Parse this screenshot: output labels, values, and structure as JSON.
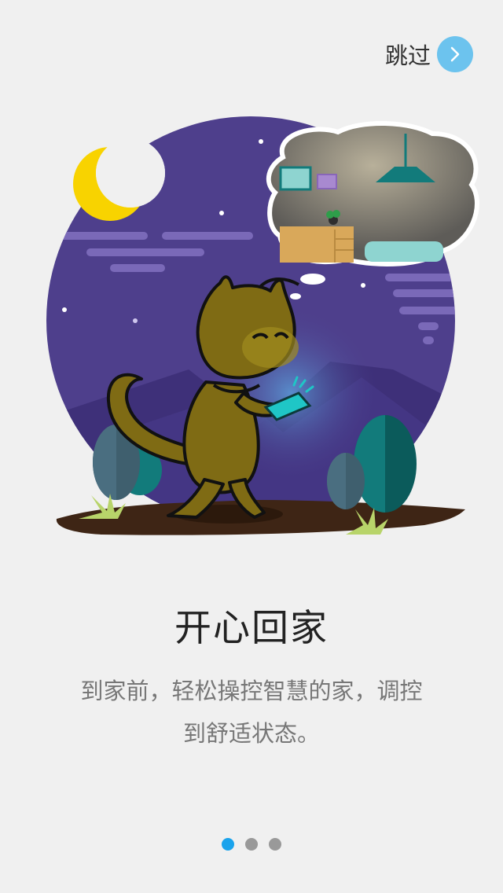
{
  "header": {
    "skip_label": "跳过",
    "skip_icon": "chevron-right-icon"
  },
  "illustration": {
    "subject": "cat-using-phone-dreaming-of-home",
    "icons": [
      "moon-icon",
      "cat-illustration",
      "thought-bubble-room",
      "bush-icon",
      "grass-icon"
    ]
  },
  "main": {
    "title": "开心回家",
    "description_line1": "到家前，轻松操控智慧的家，调控",
    "description_line2": "到舒适状态。"
  },
  "pager": {
    "count": 3,
    "active_index": 0
  },
  "colors": {
    "background": "#f0f0f0",
    "accent": "#1aa3ec",
    "skip_button": "#6cc3ee",
    "night_sky": "#4e3f8c",
    "cat": "#7f6b14"
  }
}
